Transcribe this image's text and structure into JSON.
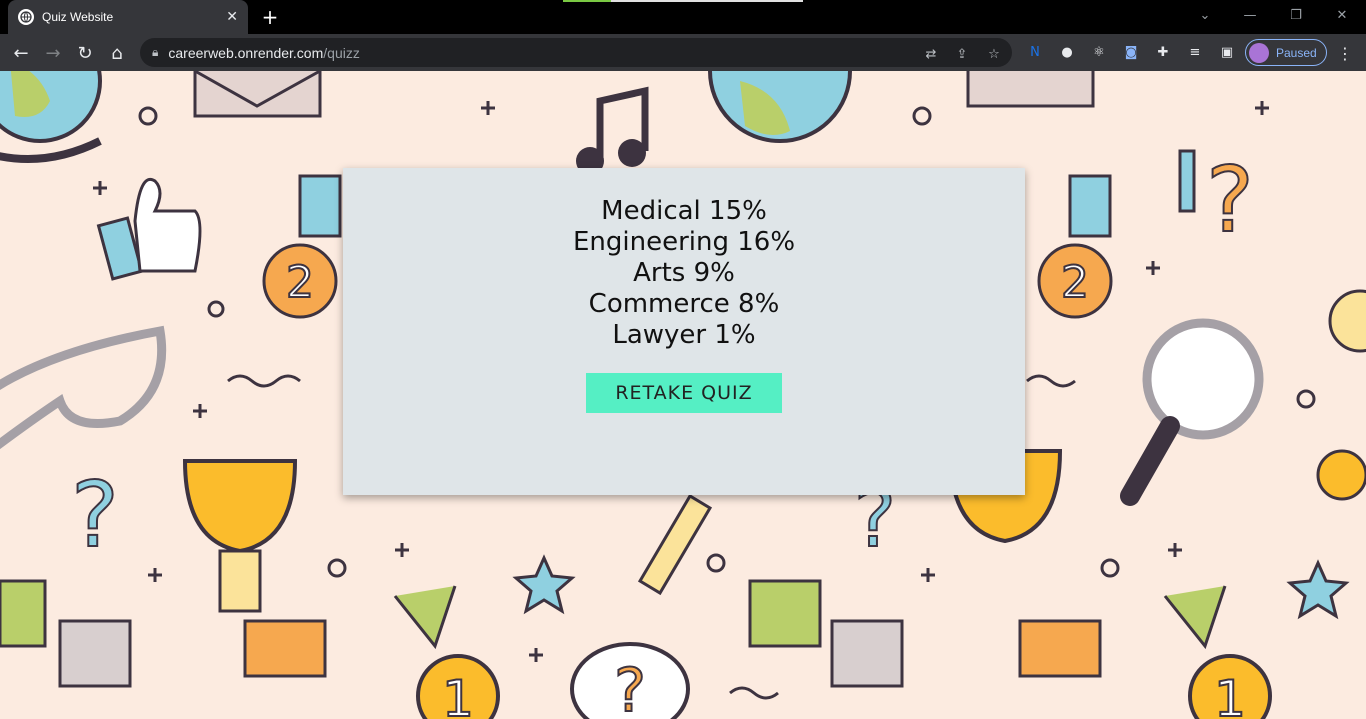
{
  "browser": {
    "tab_title": "Quiz Website",
    "tab_close": "✕",
    "new_tab": "+",
    "url_host": "careerweb.onrender.com",
    "url_path": "/quizz",
    "profile_status": "Paused"
  },
  "quiz": {
    "results": [
      {
        "label": "Medical 15%"
      },
      {
        "label": "Engineering 16%"
      },
      {
        "label": "Arts 9%"
      },
      {
        "label": "Commerce 8%"
      },
      {
        "label": "Lawyer 1%"
      }
    ],
    "retake_label": "RETAKE QUIZ"
  },
  "colors": {
    "page_background": "#fcebe0",
    "card_background": "#dfe5e8",
    "retake_button": "#55efc4"
  }
}
